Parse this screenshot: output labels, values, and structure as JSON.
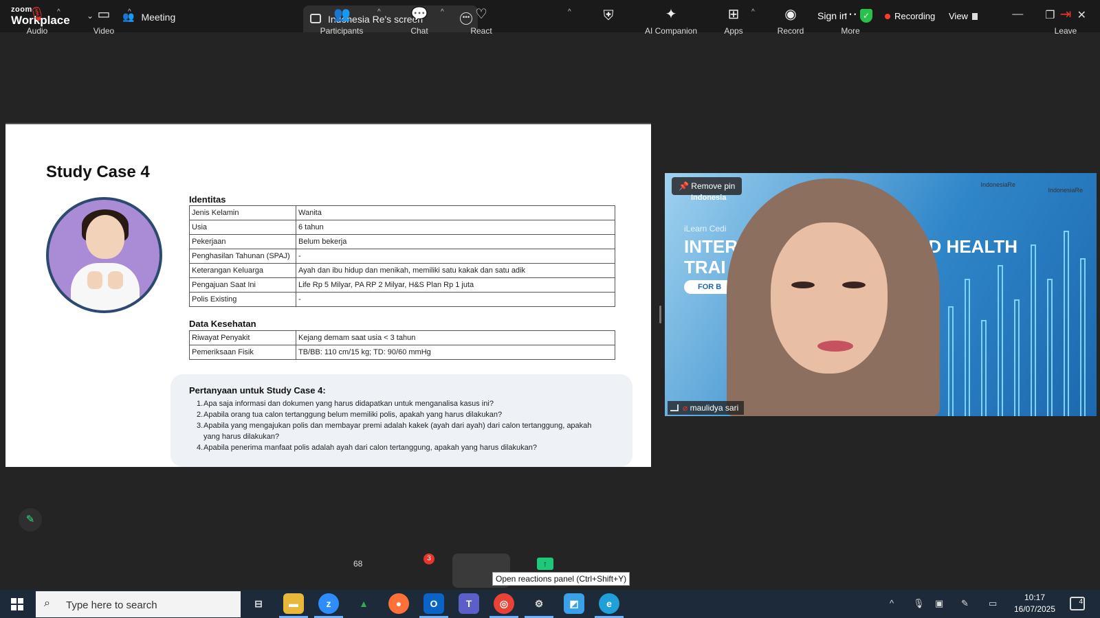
{
  "topbar": {
    "logo_small": "zoom",
    "logo_big": "Workplace",
    "meeting_tab": "Meeting",
    "screen_tab": "Indonesia Re's screen",
    "sign_in": "Sign in",
    "recording": "Recording",
    "view": "View"
  },
  "slide": {
    "title": "Study Case 4",
    "identitas_title": "Identitas",
    "identitas": [
      {
        "k": "Jenis Kelamin",
        "v": "Wanita"
      },
      {
        "k": "Usia",
        "v": "6 tahun"
      },
      {
        "k": "Pekerjaan",
        "v": "Belum bekerja"
      },
      {
        "k": "Penghasilan Tahunan (SPAJ)",
        "v": "-"
      },
      {
        "k": "Keterangan Keluarga",
        "v": "Ayah dan ibu hidup dan menikah, memiliki satu kakak dan satu adik"
      },
      {
        "k": "Pengajuan Saat Ini",
        "v": "Life Rp 5 Milyar, PA RP 2 Milyar, H&S Plan Rp 1 juta"
      },
      {
        "k": "Polis Existing",
        "v": "-"
      }
    ],
    "kesehatan_title": "Data Kesehatan",
    "kesehatan": [
      {
        "k": "Riwayat Penyakit",
        "v": "Kejang demam saat usia < 3 tahun"
      },
      {
        "k": "Pemeriksaan Fisik",
        "v": "TB/BB: 110 cm/15 kg; TD: 90/60 mmHg"
      }
    ],
    "questions_title": "Pertanyaan untuk Study Case 4:",
    "questions": [
      {
        "n": "1.",
        "t": "Apa saja informasi dan dokumen yang harus didapatkan untuk menganalisa kasus ini?"
      },
      {
        "n": "2.",
        "t": "Apabila orang tua calon tertanggung belum memiliki polis, apakah yang harus dilakukan?"
      },
      {
        "n": "3.",
        "t": "Apabila yang mengajukan polis dan membayar premi adalah kakek (ayah dari ayah) dari calon tertanggung, apakah yang harus dilakukan?"
      },
      {
        "n": "4.",
        "t": "Apabila penerima manfaat polis adalah ayah dari calon tertanggung, apakah yang harus dilakukan?"
      }
    ]
  },
  "video": {
    "remove_pin": "Remove pin",
    "participant_name": "maulidya sari",
    "bg_small": "iLearn Cedi",
    "bg_line1": "INTER",
    "bg_line1b": "AND HEALTH",
    "bg_line2": "TRAI",
    "bg_btn": "FOR B",
    "bg_indonesia": "Indonesia",
    "bg_logo1": "IndonesiaRe",
    "bg_logo2": "IndonesiaRe"
  },
  "toolbar": {
    "audio": "Audio",
    "video": "Video",
    "participants": "Participants",
    "participant_count": "68",
    "chat": "Chat",
    "chat_badge": "3",
    "react": "React",
    "ai_companion": "AI Companion",
    "apps": "Apps",
    "record": "Record",
    "more": "More",
    "leave": "Leave",
    "tooltip": "Open reactions panel (Ctrl+Shift+Y)"
  },
  "taskbar": {
    "search_placeholder": "Type here to search",
    "time": "10:17",
    "date": "16/07/2025",
    "notif_count": "4"
  },
  "colors": {
    "accent_green": "#1ec87a",
    "record_red": "#ff3b30",
    "shield_green": "#27c24c"
  }
}
